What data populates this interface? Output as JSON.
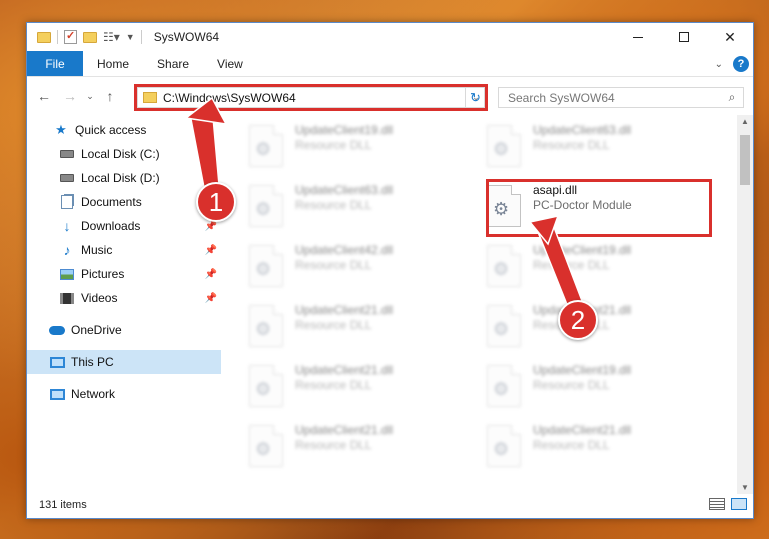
{
  "window": {
    "title": "SysWOW64"
  },
  "ribbon": {
    "tabs": [
      "File",
      "Home",
      "Share",
      "View"
    ],
    "help": "?"
  },
  "address": {
    "path": "C:\\Windows\\SysWOW64"
  },
  "search": {
    "placeholder": "Search SysWOW64"
  },
  "sidebar": {
    "items": [
      {
        "label": "Quick access",
        "icon": "star-icon",
        "pinned": false
      },
      {
        "label": "Local Disk (C:)",
        "icon": "disk-icon",
        "pinned": false
      },
      {
        "label": "Local Disk (D:)",
        "icon": "disk-icon",
        "pinned": false
      },
      {
        "label": "Documents",
        "icon": "documents-icon",
        "pinned": true
      },
      {
        "label": "Downloads",
        "icon": "download-icon",
        "pinned": true
      },
      {
        "label": "Music",
        "icon": "music-icon",
        "pinned": true
      },
      {
        "label": "Pictures",
        "icon": "pictures-icon",
        "pinned": true
      },
      {
        "label": "Videos",
        "icon": "videos-icon",
        "pinned": true
      },
      {
        "label": "OneDrive",
        "icon": "onedrive-icon",
        "pinned": false
      },
      {
        "label": "This PC",
        "icon": "pc-icon",
        "pinned": false,
        "selected": true
      },
      {
        "label": "Network",
        "icon": "network-icon",
        "pinned": false
      }
    ]
  },
  "files": [
    {
      "name": "UpdateClient19.dll",
      "desc": "Resource DLL",
      "blurred": true
    },
    {
      "name": "UpdateClient63.dll",
      "desc": "Resource DLL",
      "blurred": true
    },
    {
      "name": "UpdateClient63.dll",
      "desc": "Resource DLL",
      "blurred": true
    },
    {
      "name": "asapi.dll",
      "desc": "PC-Doctor Module",
      "blurred": false,
      "highlighted": true
    },
    {
      "name": "UpdateClient42.dll",
      "desc": "Resource DLL",
      "blurred": true
    },
    {
      "name": "UpdateClient19.dll",
      "desc": "Resource DLL",
      "blurred": true
    },
    {
      "name": "UpdateClient21.dll",
      "desc": "Resource DLL",
      "blurred": true
    },
    {
      "name": "UpdateClient21.dll",
      "desc": "Resource DLL",
      "blurred": true
    },
    {
      "name": "UpdateClient21.dll",
      "desc": "Resource DLL",
      "blurred": true
    },
    {
      "name": "UpdateClient19.dll",
      "desc": "Resource DLL",
      "blurred": true
    },
    {
      "name": "UpdateClient21.dll",
      "desc": "Resource DLL",
      "blurred": true
    },
    {
      "name": "UpdateClient21.dll",
      "desc": "Resource DLL",
      "blurred": true
    }
  ],
  "status": {
    "item_count": "131 items"
  },
  "callouts": {
    "step1": "1",
    "step2": "2"
  },
  "colors": {
    "accent": "#1979ca",
    "callout": "#d9302c",
    "selected": "#cce4f7"
  }
}
